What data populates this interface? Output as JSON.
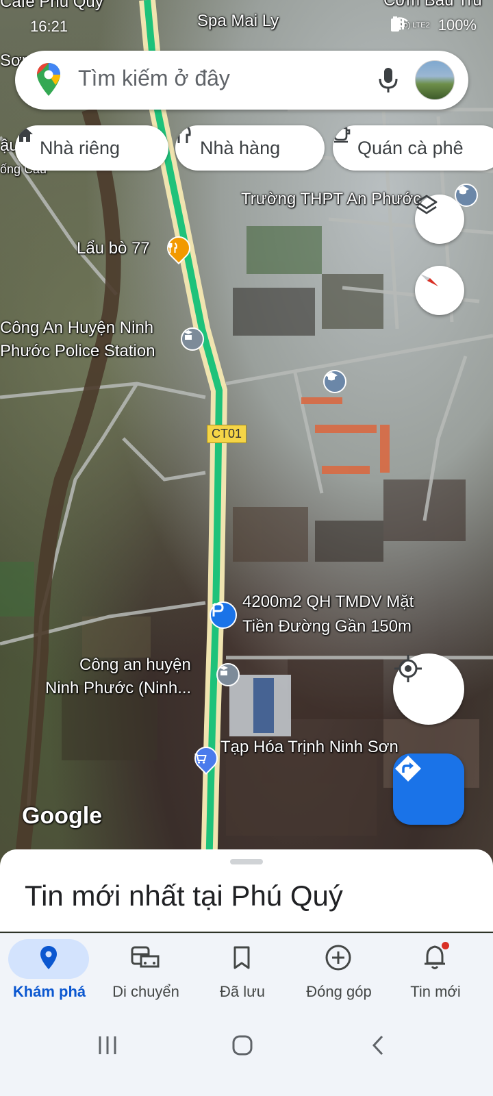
{
  "status_bar": {
    "time": "16:21",
    "network": "Vo) LTE2",
    "battery": "100%"
  },
  "search": {
    "placeholder": "Tìm kiếm ở đây"
  },
  "chips": [
    {
      "label": "Nhà riêng",
      "icon": "home-icon"
    },
    {
      "label": "Nhà hàng",
      "icon": "restaurant-icon"
    },
    {
      "label": "Quán cà phê",
      "icon": "coffee-icon"
    }
  ],
  "map": {
    "labels": {
      "cafe_phu_quy": "Cafe Phú Quý",
      "spa_mai_ly": "Spa Mai Ly",
      "com_bau_tru": "Cơm Bầu Trú",
      "son": "Sơn",
      "truong_thpt": "Trường THPT An Phước",
      "lau_bo": "Lẩu bò 77",
      "cong_an_1": "Công An Huyện Ninh",
      "cong_an_2": "Phước Police Station",
      "road_badge": "CT01",
      "ad_line1": "4200m2 QH TMDV Mặt",
      "ad_line2": "Tiền Đường Gần 150m",
      "cong_an_b1": "Công an huyện",
      "cong_an_b2": "Ninh Phước (Ninh...",
      "tap_hoa": "Tạp Hóa Trịnh Ninh Sơn",
      "google_logo": "Google",
      "left_edge_1": "ậu",
      "left_edge_2": "ống Cầu"
    }
  },
  "sheet": {
    "title": "Tin mới nhất tại Phú Quý"
  },
  "nav": {
    "items": [
      {
        "label": "Khám phá",
        "icon": "explore-pin-icon",
        "active": true
      },
      {
        "label": "Di chuyển",
        "icon": "commute-icon",
        "active": false
      },
      {
        "label": "Đã lưu",
        "icon": "bookmark-icon",
        "active": false
      },
      {
        "label": "Đóng góp",
        "icon": "add-circle-icon",
        "active": false
      },
      {
        "label": "Tin mới",
        "icon": "bell-icon",
        "active": false
      }
    ]
  },
  "colors": {
    "accent_blue": "#1a73e8",
    "active_pill": "#d3e3fd",
    "active_label": "#0b57d0",
    "road_green": "#1ec27a",
    "notification_dot": "#d93025"
  }
}
